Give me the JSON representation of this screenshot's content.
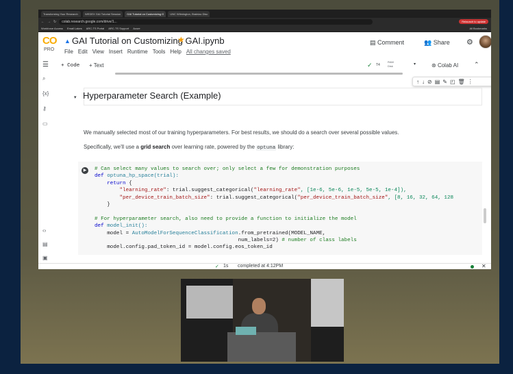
{
  "browser": {
    "tabs": [
      "Transforming Your Research",
      "WEDEX GAI Tutorial Session",
      "GAI Tutorial on Customizing G",
      "UNC Wilmington, Brainiac Disc"
    ],
    "url": "colab.research.google.com/drive/1...",
    "update_label": "Relaunch to update",
    "bookmarks": [
      "Workforce Access",
      "Email Lakes",
      "ARC-TS Portal",
      "ARC-TS Support",
      "Azure"
    ],
    "all_bookmarks": "All Bookmarks"
  },
  "header": {
    "logo": "CO",
    "pro": "PRO",
    "title": "GAI Tutorial on Customizing GAI.ipynb",
    "menu": [
      "File",
      "Edit",
      "View",
      "Insert",
      "Runtime",
      "Tools",
      "Help"
    ],
    "saved": "All changes saved",
    "comment": "Comment",
    "share": "Share"
  },
  "toolbar": {
    "code": "+ Code",
    "text": "+ Text",
    "runtime": "T4",
    "ram": "RAM",
    "disk": "Disk",
    "colab_ai": "Colab AI"
  },
  "section": {
    "title": "Hyperparameter Search (Example)",
    "para1": "We manually selected most of our training hyperparameters. For best results, we should do a search over several possible values.",
    "para2_pre": "Specifically, we'll use a ",
    "para2_bold": "grid search",
    "para2_mid": " over learning rate, powered by the ",
    "para2_code": "optuna",
    "para2_post": " library:"
  },
  "code": {
    "l1": "# Can select many values to search over; only select a few for demonstration purposes",
    "l2a": "def ",
    "l2b": "optuna_hp_space(trial):",
    "l3a": "    return ",
    "l3b": "{",
    "l4a": "        \"learning_rate\"",
    "l4b": ": trial.suggest_categorical(",
    "l4c": "\"learning_rate\"",
    "l4d": ", [1e-6, 5e-6, 1e-5, 5e-5, 1e-4]),",
    "l5a": "        \"per_device_train_batch_size\"",
    "l5b": ": trial.suggest_categorical(",
    "l5c": "\"per_device_train_batch_size\"",
    "l5d": ", [8, 16, 32, 64, 128",
    "l6": "    }",
    "l7": "# For hyperparameter search, also need to provide a function to initialize the model",
    "l8a": "def ",
    "l8b": "model_init():",
    "l9a": "    model = ",
    "l9b": "AutoModelForSequenceClassification",
    "l9c": ".from_pretrained(MODEL_NAME,",
    "l10a": "                                              num_labels=2) ",
    "l10b": "# number of class labels",
    "l11": "    model.config.pad_token_id = model.config.eos_token_id"
  },
  "status": {
    "duration": "1s",
    "message": "completed at 4:12PM"
  }
}
